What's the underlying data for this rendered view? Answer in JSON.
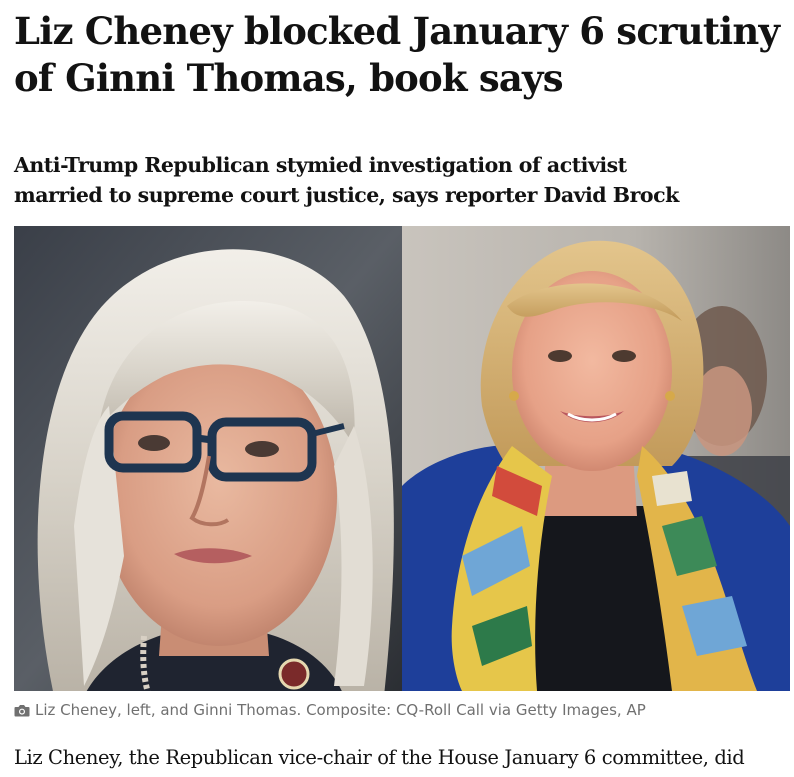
{
  "article": {
    "headline_line1": "Liz Cheney blocked January 6 scrutiny",
    "headline_line2": "of Ginni Thomas, book says",
    "standfirst_line1": "Anti-Trump Republican stymied investigation of activist",
    "standfirst_line2": "married to supreme court justice, says reporter David Brock",
    "image": {
      "left_subject": "Liz Cheney",
      "right_subject": "Ginni Thomas"
    },
    "caption": {
      "icon": "camera-icon",
      "text": "Liz Cheney, left, and Ginni Thomas. Composite: CQ-Roll Call via Getty Images, AP"
    },
    "body_first_line": "Liz Cheney, the Republican vice-chair of the House January 6 committee, did"
  },
  "colors": {
    "text": "#121212",
    "caption": "#707070",
    "background": "#ffffff"
  }
}
